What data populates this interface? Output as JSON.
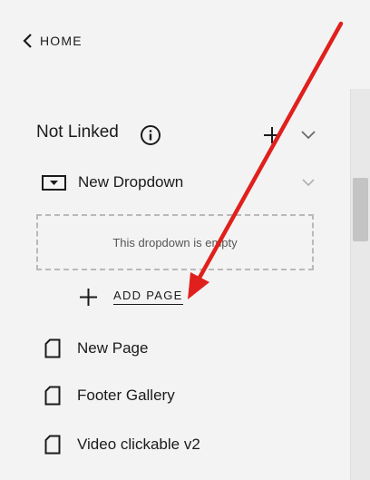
{
  "nav": {
    "home_label": "HOME"
  },
  "section": {
    "title": "Not Linked"
  },
  "dropdown": {
    "label": "New Dropdown",
    "empty_text": "This dropdown is empty"
  },
  "actions": {
    "add_page_label": "ADD PAGE"
  },
  "pages": [
    {
      "label": "New Page",
      "icon": "page-icon"
    },
    {
      "label": "Footer Gallery",
      "icon": "page-icon"
    },
    {
      "label": "Video clickable v2",
      "icon": "page-icon"
    }
  ],
  "colors": {
    "annotation_arrow": "#e0201c",
    "background": "#f3f3f3",
    "text": "#1b1b1b"
  }
}
